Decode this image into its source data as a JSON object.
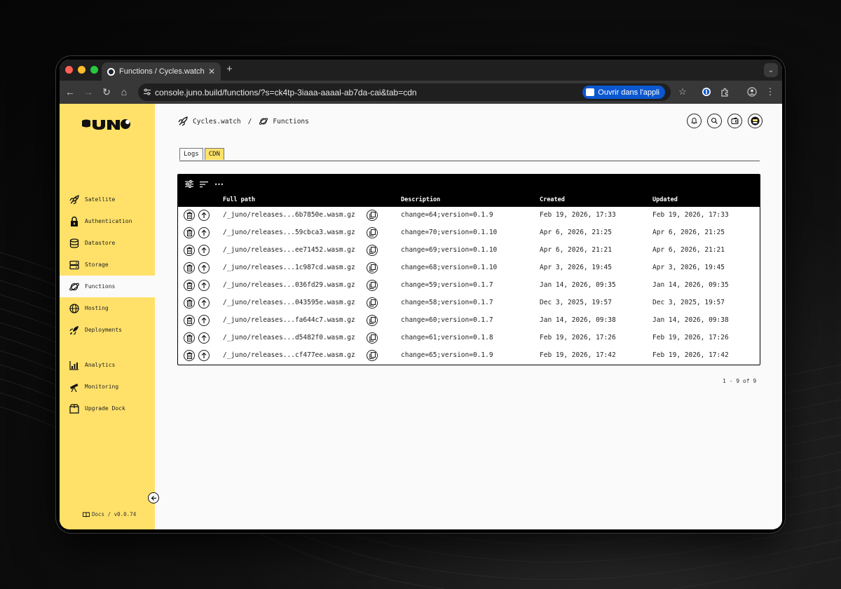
{
  "browser": {
    "tab_title": "Functions / Cycles.watch / Juno",
    "new_tab_label": "+",
    "url": "console.juno.build/functions/?s=ck4tp-3iaaa-aaaal-ab7da-cai&tab=cdn",
    "open_app_label": "Ouvrir dans l'appli"
  },
  "sidebar": {
    "logo": "JUNO",
    "items": [
      {
        "label": "Satellite",
        "icon": "rocket-icon"
      },
      {
        "label": "Authentication",
        "icon": "lock-icon"
      },
      {
        "label": "Datastore",
        "icon": "database-icon"
      },
      {
        "label": "Storage",
        "icon": "storage-icon"
      },
      {
        "label": "Functions",
        "icon": "planet-icon"
      },
      {
        "label": "Hosting",
        "icon": "globe-icon"
      },
      {
        "label": "Deployments",
        "icon": "rocket-launch-icon"
      },
      {
        "label": "Analytics",
        "icon": "chart-icon"
      },
      {
        "label": "Monitoring",
        "icon": "telescope-icon"
      },
      {
        "label": "Upgrade Dock",
        "icon": "box-icon"
      }
    ],
    "docs": "Docs / v0.0.74"
  },
  "breadcrumb": {
    "satellite": "Cycles.watch",
    "separator": "/",
    "page": "Functions"
  },
  "tabs": [
    {
      "label": "Logs",
      "active": false
    },
    {
      "label": "CDN",
      "active": true
    }
  ],
  "table": {
    "columns": [
      "Full path",
      "Description",
      "Created",
      "Updated"
    ],
    "more_label": "⋯",
    "rows": [
      {
        "path": "/_juno/releases...6b7850e.wasm.gz",
        "description": "change=64;version=0.1.9",
        "created": "Feb 19, 2026, 17:33",
        "updated": "Feb 19, 2026, 17:33"
      },
      {
        "path": "/_juno/releases...59cbca3.wasm.gz",
        "description": "change=70;version=0.1.10",
        "created": "Apr 6, 2026, 21:25",
        "updated": "Apr 6, 2026, 21:25"
      },
      {
        "path": "/_juno/releases...ee71452.wasm.gz",
        "description": "change=69;version=0.1.10",
        "created": "Apr 6, 2026, 21:21",
        "updated": "Apr 6, 2026, 21:21"
      },
      {
        "path": "/_juno/releases...1c987cd.wasm.gz",
        "description": "change=68;version=0.1.10",
        "created": "Apr 3, 2026, 19:45",
        "updated": "Apr 3, 2026, 19:45"
      },
      {
        "path": "/_juno/releases...036fd29.wasm.gz",
        "description": "change=59;version=0.1.7",
        "created": "Jan 14, 2026, 09:35",
        "updated": "Jan 14, 2026, 09:35"
      },
      {
        "path": "/_juno/releases...043595e.wasm.gz",
        "description": "change=58;version=0.1.7",
        "created": "Dec 3, 2025, 19:57",
        "updated": "Dec 3, 2025, 19:57"
      },
      {
        "path": "/_juno/releases...fa644c7.wasm.gz",
        "description": "change=60;version=0.1.7",
        "created": "Jan 14, 2026, 09:38",
        "updated": "Jan 14, 2026, 09:38"
      },
      {
        "path": "/_juno/releases...d5482f0.wasm.gz",
        "description": "change=61;version=0.1.8",
        "created": "Feb 19, 2026, 17:26",
        "updated": "Feb 19, 2026, 17:26"
      },
      {
        "path": "/_juno/releases...cf477ee.wasm.gz",
        "description": "change=65;version=0.1.9",
        "created": "Feb 19, 2026, 17:42",
        "updated": "Feb 19, 2026, 17:42"
      }
    ],
    "pagination": "1 - 9 of 9"
  },
  "colors": {
    "accent": "#ffe169",
    "sidebar_bg": "#ffe169",
    "header_bg": "#000000",
    "open_app_bg": "#0b57d0"
  }
}
